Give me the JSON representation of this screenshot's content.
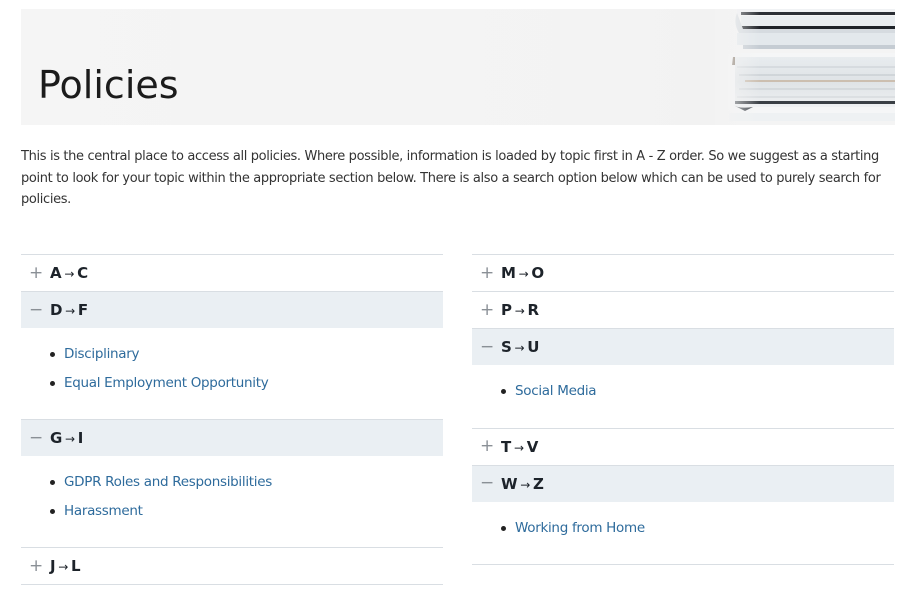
{
  "banner": {
    "title": "Policies",
    "image": "books-stack-image"
  },
  "intro": {
    "text": "This is the central place to access all policies. Where possible, information is loaded by topic first in A - Z order. So we suggest as a starting point to look for your topic within the appropriate section below.  There is also a search option below which can be used to purely search for policies."
  },
  "icons": {
    "expand": "+",
    "collapse": "−",
    "arrow": "→"
  },
  "colors": {
    "link": "#2e6b9c",
    "open_header_bg": "#eaeff3",
    "divider": "#d9dee3"
  },
  "left_column": [
    {
      "from": "A",
      "to": "C",
      "open": false,
      "items": []
    },
    {
      "from": "D",
      "to": "F",
      "open": true,
      "items": [
        "Disciplinary",
        "Equal Employment Opportunity"
      ]
    },
    {
      "from": "G",
      "to": "I",
      "open": true,
      "items": [
        "GDPR Roles and Responsibilities",
        "Harassment"
      ]
    },
    {
      "from": "J",
      "to": "L",
      "open": false,
      "items": []
    }
  ],
  "right_column": [
    {
      "from": "M",
      "to": "O",
      "open": false,
      "items": []
    },
    {
      "from": "P",
      "to": "R",
      "open": false,
      "items": []
    },
    {
      "from": "S",
      "to": "U",
      "open": true,
      "items": [
        "Social Media"
      ]
    },
    {
      "from": "T",
      "to": "V",
      "open": false,
      "items": []
    },
    {
      "from": "W",
      "to": "Z",
      "open": true,
      "items": [
        "Working from Home"
      ]
    }
  ]
}
